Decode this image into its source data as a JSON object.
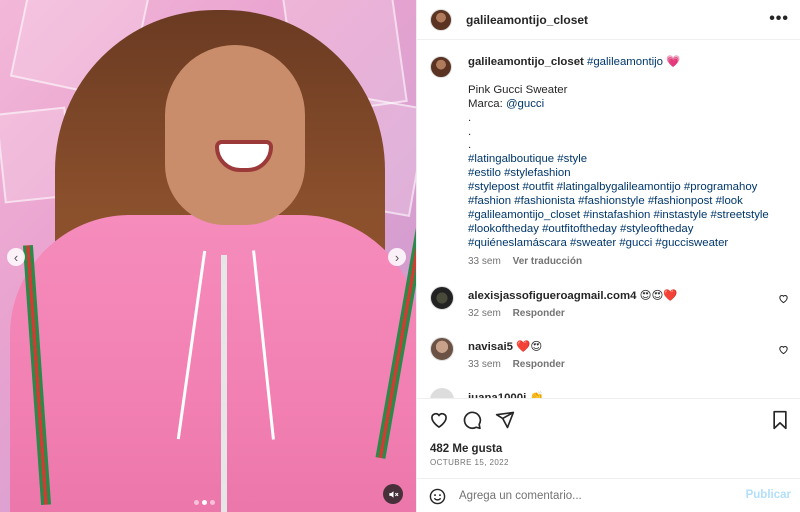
{
  "post": {
    "username": "galileamontijo_closet",
    "more_icon": "more-icon",
    "more_text": "•••"
  },
  "media": {
    "prev_glyph": "‹",
    "next_glyph": "›",
    "carousel_count": 3,
    "carousel_active": 2,
    "mute_icon": "mute-icon"
  },
  "caption": {
    "username": "galileamontijo_closet",
    "hashtag_main": "#galileamontijo",
    "emoji": "💗",
    "line_title": "Pink Gucci Sweater",
    "marca_label": "Marca: ",
    "marca_handle": "@gucci",
    "dot": ".",
    "hashtag_lines": [
      "#latingalboutique #style",
      "#estilo #stylefashion",
      "#stylepost #outfit #latingalbygalileamontijo #programahoy",
      "#fashion #fashionista #fashionstyle #fashionpost #look",
      "#galileamontijo_closet #instafashion #instastyle #streetstyle",
      "#lookoftheday #outfitoftheday #styleoftheday",
      "#quiéneslamáscara #sweater #gucci #guccisweater"
    ],
    "time": "33 sem",
    "translate": "Ver traducción"
  },
  "comments": [
    {
      "username": "alexisjassofigueroagmail.com4",
      "text": "😍😍❤️",
      "time": "32 sem",
      "reply": "Responder"
    },
    {
      "username": "navisai5",
      "text": "❤️😍",
      "time": "33 sem",
      "reply": "Responder"
    },
    {
      "username": "juana1000j",
      "text": "👏"
    }
  ],
  "actions": {
    "likes": "482 Me gusta",
    "date": "OCTUBRE 15, 2022"
  },
  "add_comment": {
    "placeholder": "Agrega un comentario...",
    "post_label": "Publicar"
  },
  "colors": {
    "link": "#00376b",
    "muted": "#737373",
    "publish_disabled": "#b2dffc"
  }
}
